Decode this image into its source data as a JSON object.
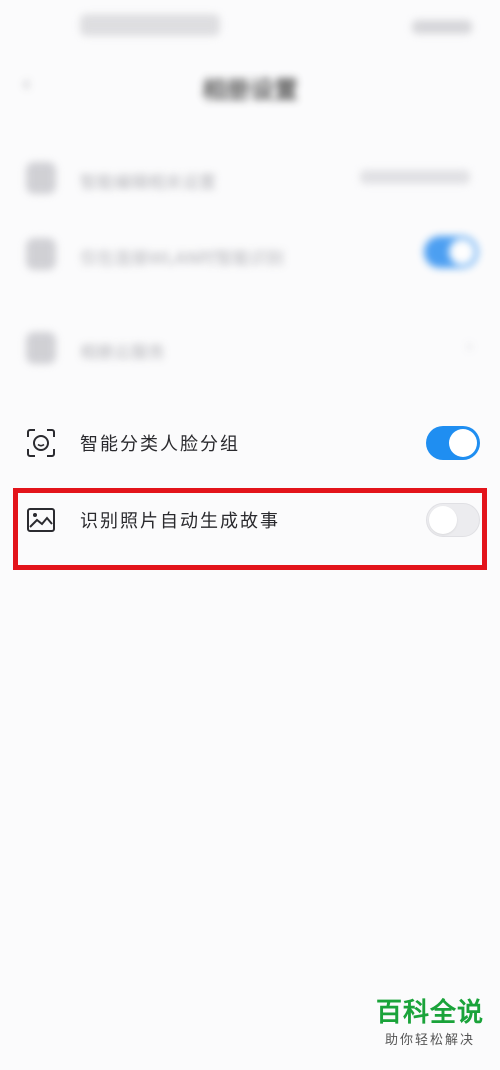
{
  "header": {
    "title": "相册设置"
  },
  "blurred_rows": [
    {
      "label": "智能编辑相关设置",
      "control": "value"
    },
    {
      "label": "仅在连接WLAN时智能识别",
      "control": "toggle-on"
    },
    {
      "label": "相册云服务",
      "control": "chevron"
    }
  ],
  "settings": [
    {
      "label": "智能分类人脸分组",
      "icon": "face-recognition-icon",
      "toggle": "on"
    },
    {
      "label": "识别照片自动生成故事",
      "icon": "image-icon",
      "toggle": "off"
    }
  ],
  "watermark": {
    "main": "百科全说",
    "sub": "助你轻松解决"
  },
  "colors": {
    "toggle_on": "#1f8ef1",
    "highlight": "#e3141b",
    "watermark_green": "#1aa33a"
  }
}
